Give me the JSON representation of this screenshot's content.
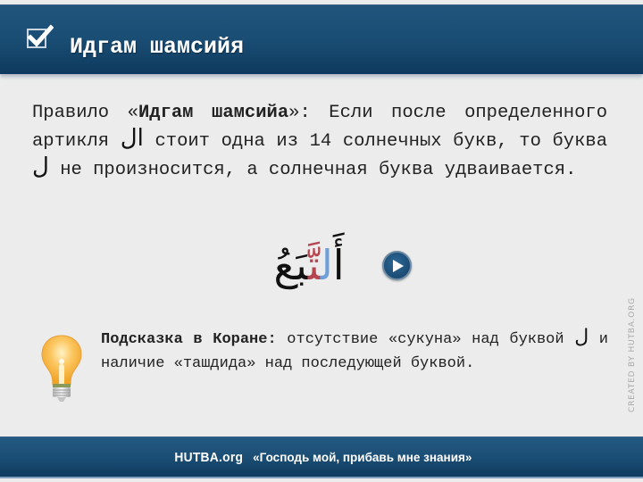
{
  "header": {
    "title": "Идгам шамсийя",
    "icon": "checkbox-checked-icon"
  },
  "rule": {
    "prefix": "Правило ",
    "quote_open": "«",
    "term": "Идгам шамсийа",
    "quote_close": "»",
    "after_term": ": Если после определенного артикля ",
    "article_arabic": "ال",
    "after_article": " стоит одна из 14 солнечных букв, то буква ",
    "lam_arabic": "ل",
    "ending": " не произносится, а солнечная буква удваивается."
  },
  "example": {
    "alif_part": "أَ",
    "lam_part": "ل",
    "ta_part": "تَّ",
    "rest_part": "بَعُ",
    "full_word": "أَلتَّبَعُ",
    "lam_color": "#6f9fd8",
    "ta_color": "#b54650",
    "play_icon": "play-icon"
  },
  "hint": {
    "icon": "lightbulb-icon",
    "label": "Подсказка в Коране:",
    "text_before": " отсутствие «сукуна» над буквой ",
    "lam_arabic": "ل",
    "text_after": " и наличие «ташдида» над последующей буквой."
  },
  "credit": "CREATED BY HUTBA.ORG",
  "footer": {
    "brand": "HUTBA.org",
    "motto": "«Господь мой, прибавь мне знания»"
  },
  "colors": {
    "bar_blue": "#1a4d74",
    "background": "#ececec",
    "text": "#222222"
  }
}
